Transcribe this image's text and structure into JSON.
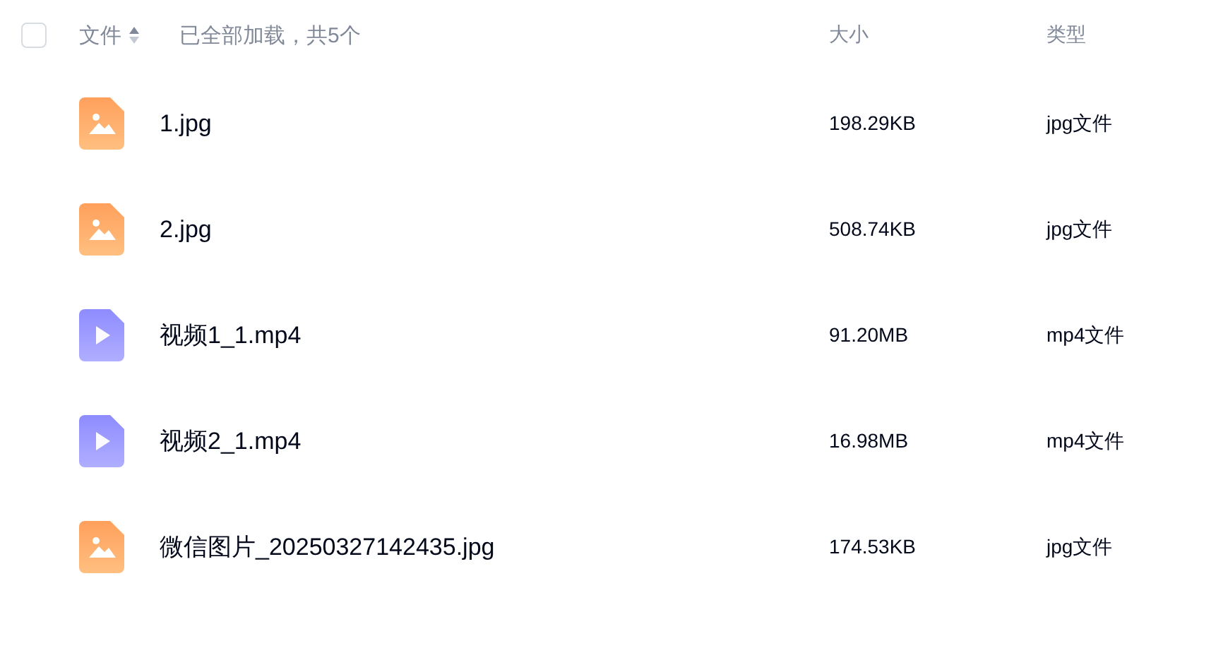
{
  "header": {
    "select_all_checked": false,
    "name_column": "文件",
    "load_status": "已全部加载，共5个",
    "size_column": "大小",
    "type_column": "类型"
  },
  "files": [
    {
      "kind": "image",
      "name": "1.jpg",
      "size": "198.29KB",
      "type": "jpg文件"
    },
    {
      "kind": "image",
      "name": "2.jpg",
      "size": "508.74KB",
      "type": "jpg文件"
    },
    {
      "kind": "video",
      "name": "视频1_1.mp4",
      "size": "91.20MB",
      "type": "mp4文件"
    },
    {
      "kind": "video",
      "name": "视频2_1.mp4",
      "size": "16.98MB",
      "type": "mp4文件"
    },
    {
      "kind": "image",
      "name": "微信图片_20250327142435.jpg",
      "size": "174.53KB",
      "type": "jpg文件"
    }
  ]
}
